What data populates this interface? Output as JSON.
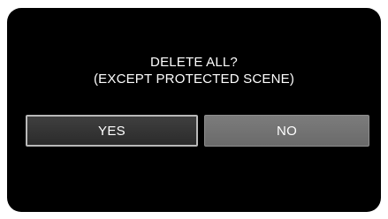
{
  "dialog": {
    "message_line1": "DELETE ALL?",
    "message_line2": "(EXCEPT PROTECTED SCENE)",
    "yes_label": "YES",
    "no_label": "NO"
  },
  "colors": {
    "screen_background": "#000000",
    "text": "#ffffff",
    "yes_button": "#333333",
    "yes_border": "#b9b9b9",
    "no_button": "#737373"
  }
}
